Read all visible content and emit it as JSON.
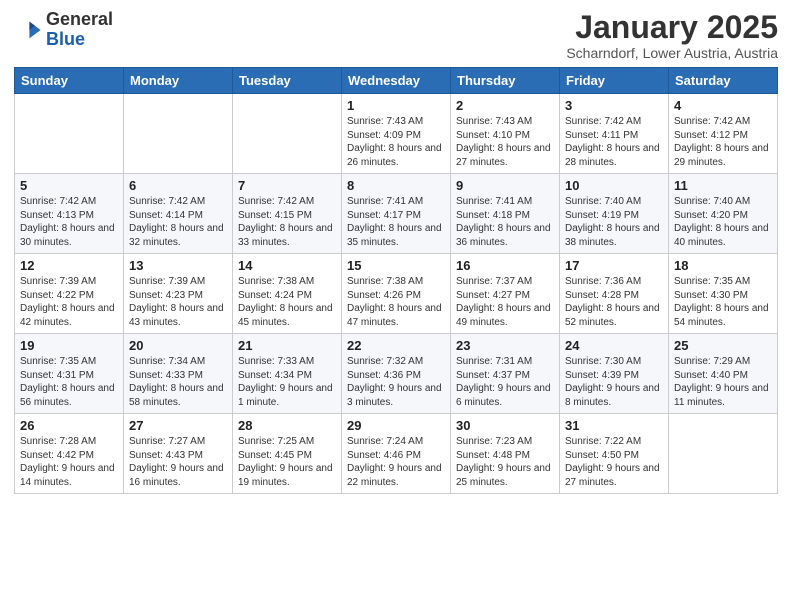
{
  "header": {
    "logo_general": "General",
    "logo_blue": "Blue",
    "month_title": "January 2025",
    "location": "Scharndorf, Lower Austria, Austria"
  },
  "days_of_week": [
    "Sunday",
    "Monday",
    "Tuesday",
    "Wednesday",
    "Thursday",
    "Friday",
    "Saturday"
  ],
  "weeks": [
    [
      {
        "day": "",
        "info": ""
      },
      {
        "day": "",
        "info": ""
      },
      {
        "day": "",
        "info": ""
      },
      {
        "day": "1",
        "info": "Sunrise: 7:43 AM\nSunset: 4:09 PM\nDaylight: 8 hours and 26 minutes."
      },
      {
        "day": "2",
        "info": "Sunrise: 7:43 AM\nSunset: 4:10 PM\nDaylight: 8 hours and 27 minutes."
      },
      {
        "day": "3",
        "info": "Sunrise: 7:42 AM\nSunset: 4:11 PM\nDaylight: 8 hours and 28 minutes."
      },
      {
        "day": "4",
        "info": "Sunrise: 7:42 AM\nSunset: 4:12 PM\nDaylight: 8 hours and 29 minutes."
      }
    ],
    [
      {
        "day": "5",
        "info": "Sunrise: 7:42 AM\nSunset: 4:13 PM\nDaylight: 8 hours and 30 minutes."
      },
      {
        "day": "6",
        "info": "Sunrise: 7:42 AM\nSunset: 4:14 PM\nDaylight: 8 hours and 32 minutes."
      },
      {
        "day": "7",
        "info": "Sunrise: 7:42 AM\nSunset: 4:15 PM\nDaylight: 8 hours and 33 minutes."
      },
      {
        "day": "8",
        "info": "Sunrise: 7:41 AM\nSunset: 4:17 PM\nDaylight: 8 hours and 35 minutes."
      },
      {
        "day": "9",
        "info": "Sunrise: 7:41 AM\nSunset: 4:18 PM\nDaylight: 8 hours and 36 minutes."
      },
      {
        "day": "10",
        "info": "Sunrise: 7:40 AM\nSunset: 4:19 PM\nDaylight: 8 hours and 38 minutes."
      },
      {
        "day": "11",
        "info": "Sunrise: 7:40 AM\nSunset: 4:20 PM\nDaylight: 8 hours and 40 minutes."
      }
    ],
    [
      {
        "day": "12",
        "info": "Sunrise: 7:39 AM\nSunset: 4:22 PM\nDaylight: 8 hours and 42 minutes."
      },
      {
        "day": "13",
        "info": "Sunrise: 7:39 AM\nSunset: 4:23 PM\nDaylight: 8 hours and 43 minutes."
      },
      {
        "day": "14",
        "info": "Sunrise: 7:38 AM\nSunset: 4:24 PM\nDaylight: 8 hours and 45 minutes."
      },
      {
        "day": "15",
        "info": "Sunrise: 7:38 AM\nSunset: 4:26 PM\nDaylight: 8 hours and 47 minutes."
      },
      {
        "day": "16",
        "info": "Sunrise: 7:37 AM\nSunset: 4:27 PM\nDaylight: 8 hours and 49 minutes."
      },
      {
        "day": "17",
        "info": "Sunrise: 7:36 AM\nSunset: 4:28 PM\nDaylight: 8 hours and 52 minutes."
      },
      {
        "day": "18",
        "info": "Sunrise: 7:35 AM\nSunset: 4:30 PM\nDaylight: 8 hours and 54 minutes."
      }
    ],
    [
      {
        "day": "19",
        "info": "Sunrise: 7:35 AM\nSunset: 4:31 PM\nDaylight: 8 hours and 56 minutes."
      },
      {
        "day": "20",
        "info": "Sunrise: 7:34 AM\nSunset: 4:33 PM\nDaylight: 8 hours and 58 minutes."
      },
      {
        "day": "21",
        "info": "Sunrise: 7:33 AM\nSunset: 4:34 PM\nDaylight: 9 hours and 1 minute."
      },
      {
        "day": "22",
        "info": "Sunrise: 7:32 AM\nSunset: 4:36 PM\nDaylight: 9 hours and 3 minutes."
      },
      {
        "day": "23",
        "info": "Sunrise: 7:31 AM\nSunset: 4:37 PM\nDaylight: 9 hours and 6 minutes."
      },
      {
        "day": "24",
        "info": "Sunrise: 7:30 AM\nSunset: 4:39 PM\nDaylight: 9 hours and 8 minutes."
      },
      {
        "day": "25",
        "info": "Sunrise: 7:29 AM\nSunset: 4:40 PM\nDaylight: 9 hours and 11 minutes."
      }
    ],
    [
      {
        "day": "26",
        "info": "Sunrise: 7:28 AM\nSunset: 4:42 PM\nDaylight: 9 hours and 14 minutes."
      },
      {
        "day": "27",
        "info": "Sunrise: 7:27 AM\nSunset: 4:43 PM\nDaylight: 9 hours and 16 minutes."
      },
      {
        "day": "28",
        "info": "Sunrise: 7:25 AM\nSunset: 4:45 PM\nDaylight: 9 hours and 19 minutes."
      },
      {
        "day": "29",
        "info": "Sunrise: 7:24 AM\nSunset: 4:46 PM\nDaylight: 9 hours and 22 minutes."
      },
      {
        "day": "30",
        "info": "Sunrise: 7:23 AM\nSunset: 4:48 PM\nDaylight: 9 hours and 25 minutes."
      },
      {
        "day": "31",
        "info": "Sunrise: 7:22 AM\nSunset: 4:50 PM\nDaylight: 9 hours and 27 minutes."
      },
      {
        "day": "",
        "info": ""
      }
    ]
  ]
}
